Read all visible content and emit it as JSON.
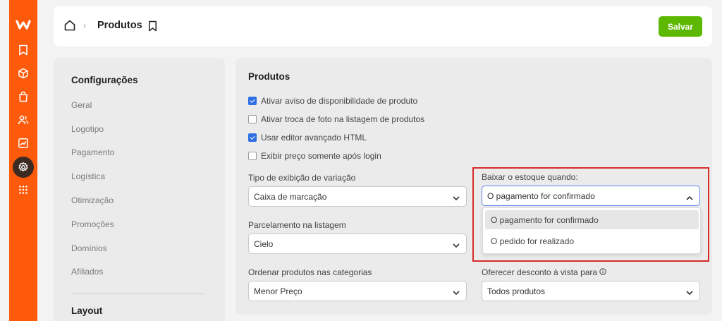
{
  "header": {
    "title": "Produtos",
    "save_label": "Salvar"
  },
  "rail": {
    "logo_color": "#ffffff",
    "brand_color": "#fe5a0b",
    "items": [
      "logo-icon",
      "bookmark-icon",
      "cube-icon",
      "bag-icon",
      "users-icon",
      "chart-icon",
      "gear-icon",
      "apps-grid-icon"
    ],
    "active_item": "gear-icon"
  },
  "sidebar": {
    "title": "Configurações",
    "items": [
      "Geral",
      "Logotipo",
      "Pagamento",
      "Logística",
      "Otimização",
      "Promoções",
      "Domínios",
      "Afiliados"
    ],
    "section2_title": "Layout"
  },
  "main": {
    "title": "Produtos",
    "checkboxes": [
      {
        "label": "Ativar aviso de disponibilidade de produto",
        "checked": true
      },
      {
        "label": "Ativar troca de foto na listagem de produtos",
        "checked": false
      },
      {
        "label": "Usar editor avançado HTML",
        "checked": true
      },
      {
        "label": "Exibir preço somente após login",
        "checked": false
      }
    ],
    "fields": {
      "variation_display": {
        "label": "Tipo de exibição de variação",
        "value": "Caixa de marcação"
      },
      "stock_trigger": {
        "label": "Baixar o estoque quando:",
        "value": "O pagamento for confirmado",
        "options": [
          "O pagamento for confirmado",
          "O pedido for realizado"
        ]
      },
      "installments": {
        "label": "Parcelamento na listagem",
        "value": "Cielo"
      },
      "sort_order": {
        "label": "Ordenar produtos nas categorias",
        "value": "Menor Preço"
      },
      "cash_discount": {
        "label": "Oferecer desconto à vista para",
        "value": "Todos produtos"
      }
    }
  },
  "colors": {
    "accent_checkbox": "#2f6fe4",
    "save_button": "#5cb800",
    "highlight_box": "#d92a2a"
  }
}
